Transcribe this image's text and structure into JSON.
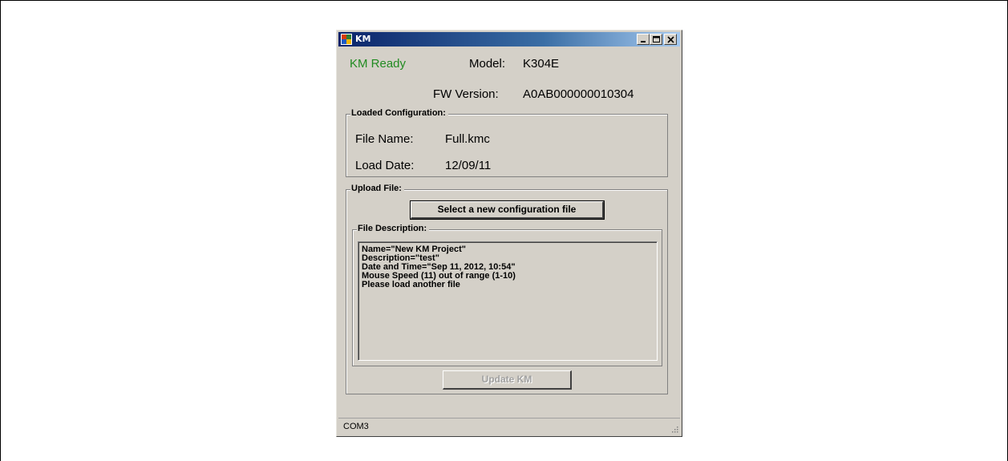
{
  "window": {
    "title": "KM",
    "controls": {
      "minimize": "minimize",
      "maximize": "maximize",
      "close": "close"
    }
  },
  "status": {
    "ready_text": "KM Ready",
    "ready_color": "#218b21"
  },
  "device": {
    "model_label": "Model:",
    "model_value": "K304E",
    "fw_label": "FW Version:",
    "fw_value": "A0AB000000010304"
  },
  "loaded_configuration": {
    "title": "Loaded Configuration:",
    "file_name_label": "File Name:",
    "file_name_value": "Full.kmc",
    "load_date_label": "Load Date:",
    "load_date_value": "12/09/11"
  },
  "upload_file": {
    "title": "Upload File:",
    "select_button": "Select a new configuration file",
    "file_description_title": "File Description:",
    "description_lines": [
      "Name=\"New KM Project\"",
      "Description=\"test\"",
      "Date and Time=\"Sep 11, 2012, 10:54\"",
      "Mouse Speed (11) out of range (1-10)",
      "Please load another file"
    ],
    "update_button": "Update KM"
  },
  "statusbar": {
    "port": "COM3"
  },
  "icons": {
    "app": "app-icon",
    "grip": "resize-grip-icon"
  }
}
